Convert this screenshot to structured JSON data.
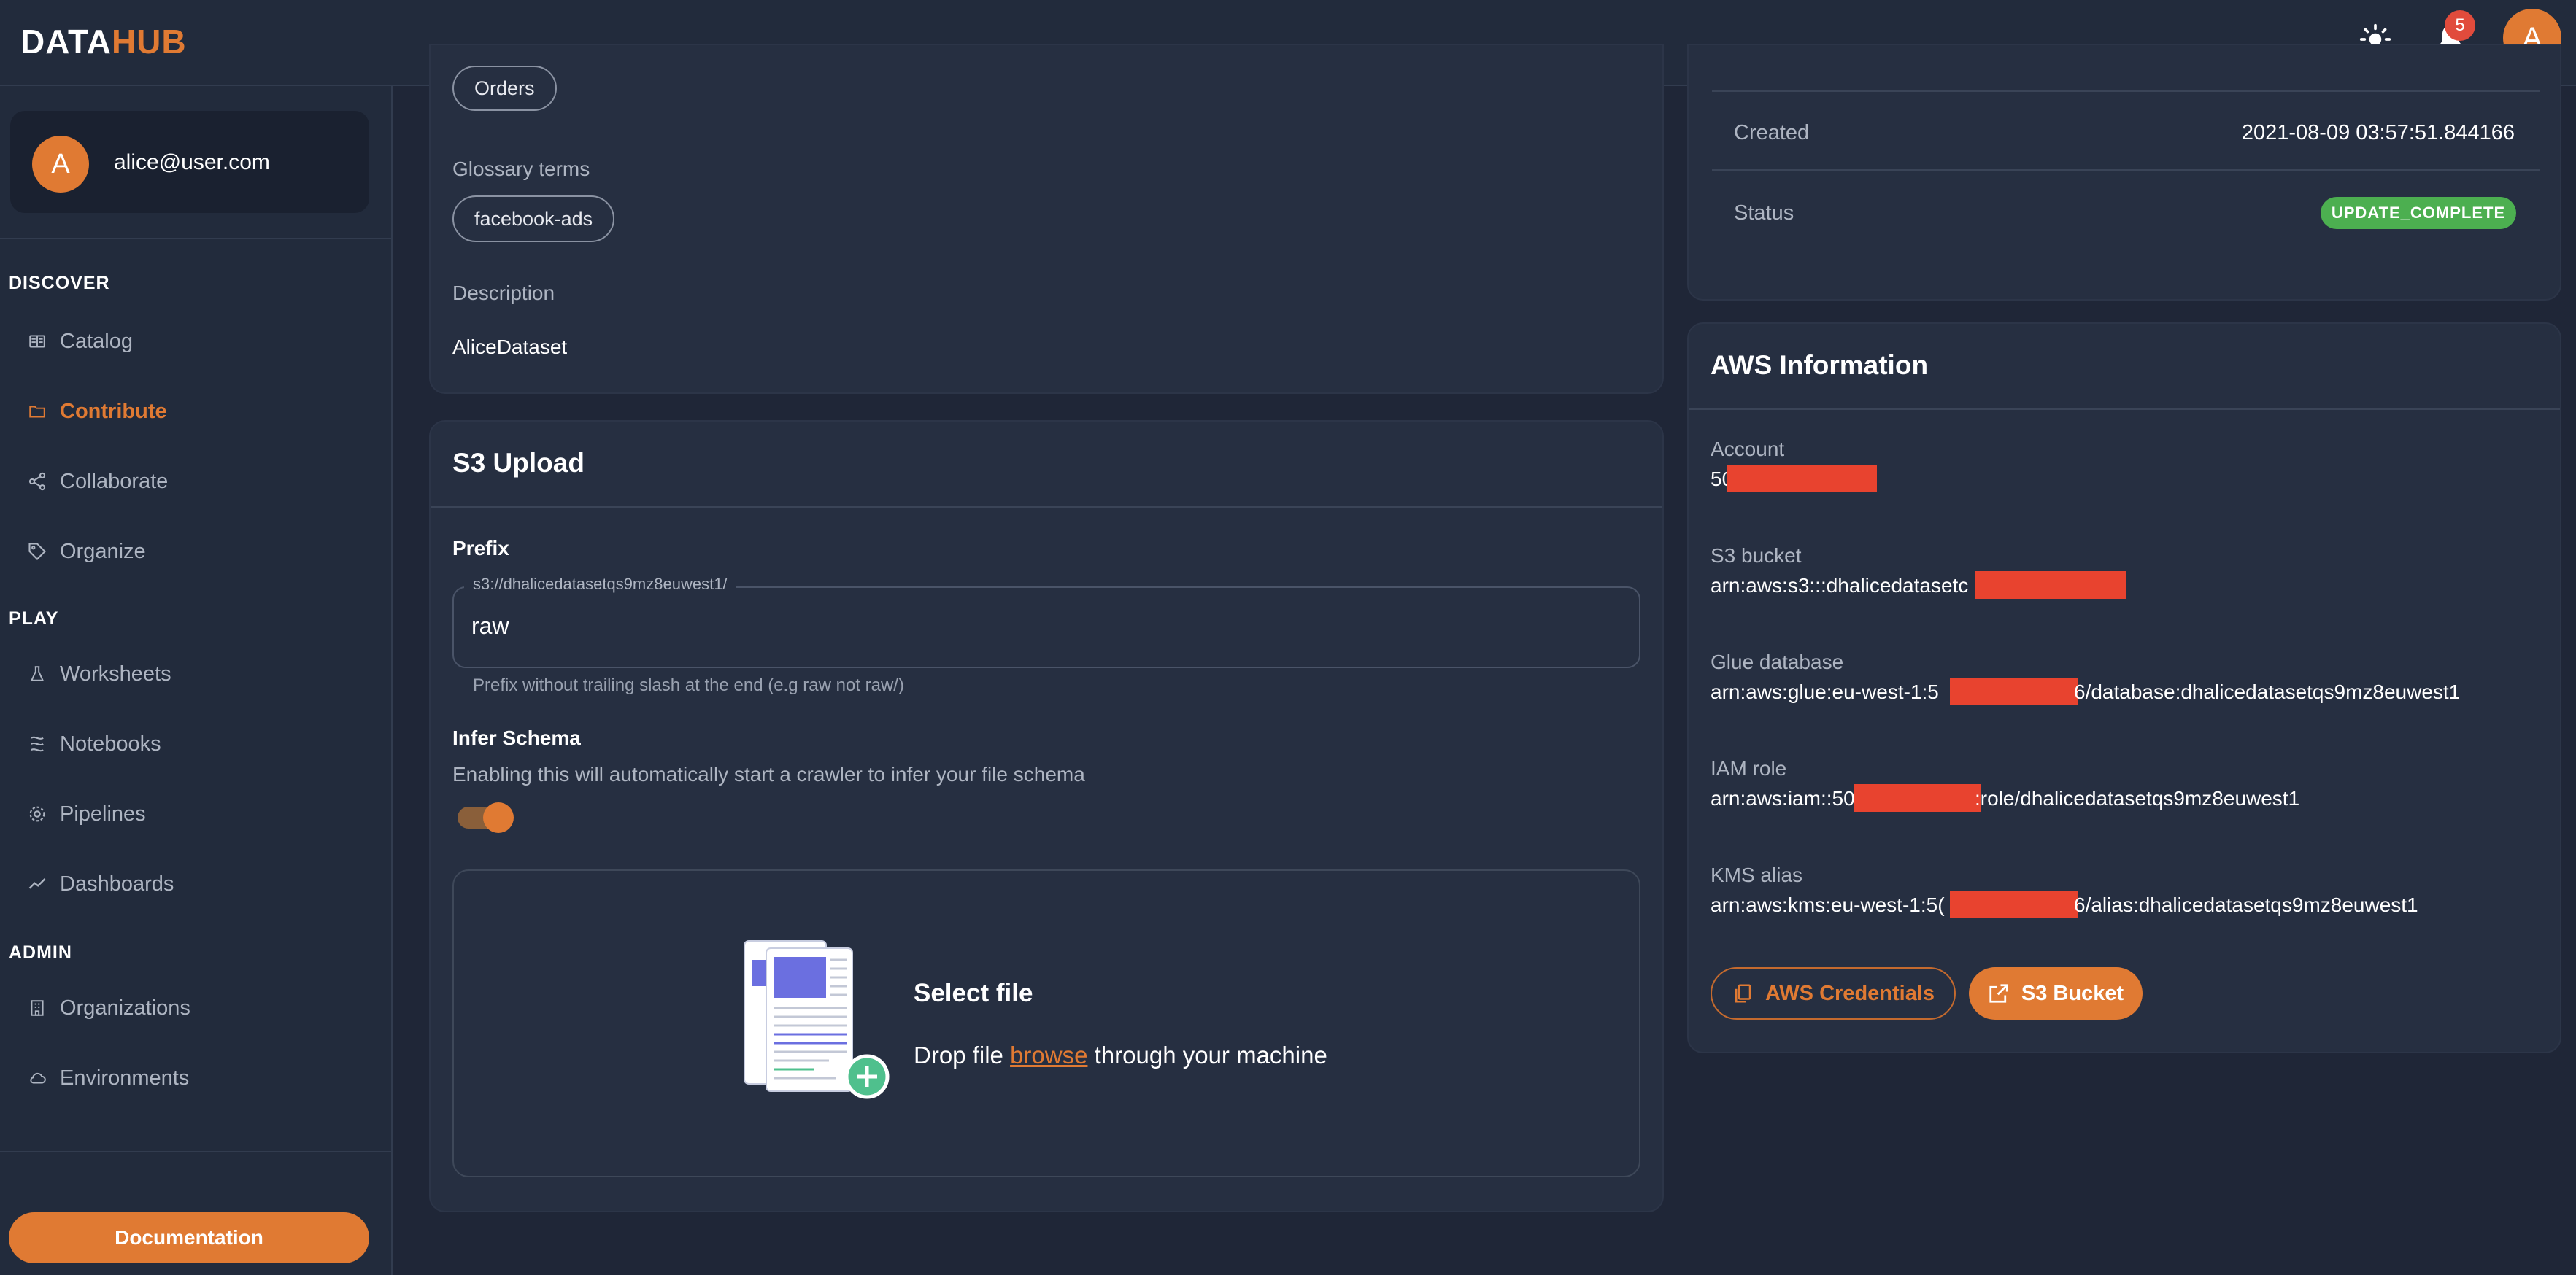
{
  "header": {
    "logo_part1": "DATA",
    "logo_part2": "HUB",
    "theme_icon": "sun-icon",
    "notifications_icon": "bell-icon",
    "notifications_count": "5",
    "avatar_initial": "A"
  },
  "sidebar": {
    "user": {
      "avatar_initial": "A",
      "email": "alice@user.com"
    },
    "sections": {
      "discover": "DISCOVER",
      "play": "PLAY",
      "admin": "ADMIN"
    },
    "items": {
      "catalog": "Catalog",
      "contribute": "Contribute",
      "collaborate": "Collaborate",
      "organize": "Organize",
      "worksheets": "Worksheets",
      "notebooks": "Notebooks",
      "pipelines": "Pipelines",
      "dashboards": "Dashboards",
      "organizations": "Organizations",
      "environments": "Environments"
    },
    "documentation_label": "Documentation"
  },
  "dataset_details": {
    "topic_chip": "Orders",
    "glossary_label": "Glossary terms",
    "glossary_chip": "facebook-ads",
    "description_label": "Description",
    "description_value": "AliceDataset"
  },
  "s3_upload": {
    "title": "S3 Upload",
    "prefix_label": "Prefix",
    "prefix_legend": "s3://dhalicedatasetqs9mz8euwest1/",
    "prefix_value": "raw",
    "prefix_helper": "Prefix without trailing slash at the end (e.g raw not raw/)",
    "infer_schema_label": "Infer Schema",
    "infer_schema_desc": "Enabling this will automatically start a crawler to infer your file schema",
    "infer_schema_on": true,
    "dropzone_title": "Select file",
    "dropzone_text_before": "Drop file ",
    "dropzone_link": "browse",
    "dropzone_text_after": " through your machine"
  },
  "stack_info": {
    "created_label": "Created",
    "created_value": "2021-08-09 03:57:51.844166",
    "status_label": "Status",
    "status_value": "UPDATE_COMPLETE"
  },
  "aws_info": {
    "title": "AWS Information",
    "account_label": "Account",
    "account_value": "50",
    "s3_bucket_label": "S3 bucket",
    "s3_bucket_value": "arn:aws:s3:::dhalicedatasetc",
    "glue_label": "Glue database",
    "glue_prefix": "arn:aws:glue:eu-west-1:5",
    "glue_suffix": "6/database:dhalicedatasetqs9mz8euwest1",
    "iam_label": "IAM role",
    "iam_prefix": "arn:aws:iam::50",
    "iam_suffix": ":role/dhalicedatasetqs9mz8euwest1",
    "kms_label": "KMS alias",
    "kms_prefix": "arn:aws:kms:eu-west-1:5(",
    "kms_suffix": "6/alias:dhalicedatasetqs9mz8euwest1",
    "aws_credentials_button": "AWS Credentials",
    "s3_bucket_button": "S3 Bucket"
  },
  "colors": {
    "accent": "#e07a33",
    "background": "#1f2637",
    "card": "#262f41",
    "success": "#4caf50",
    "redaction": "#e8432f"
  }
}
